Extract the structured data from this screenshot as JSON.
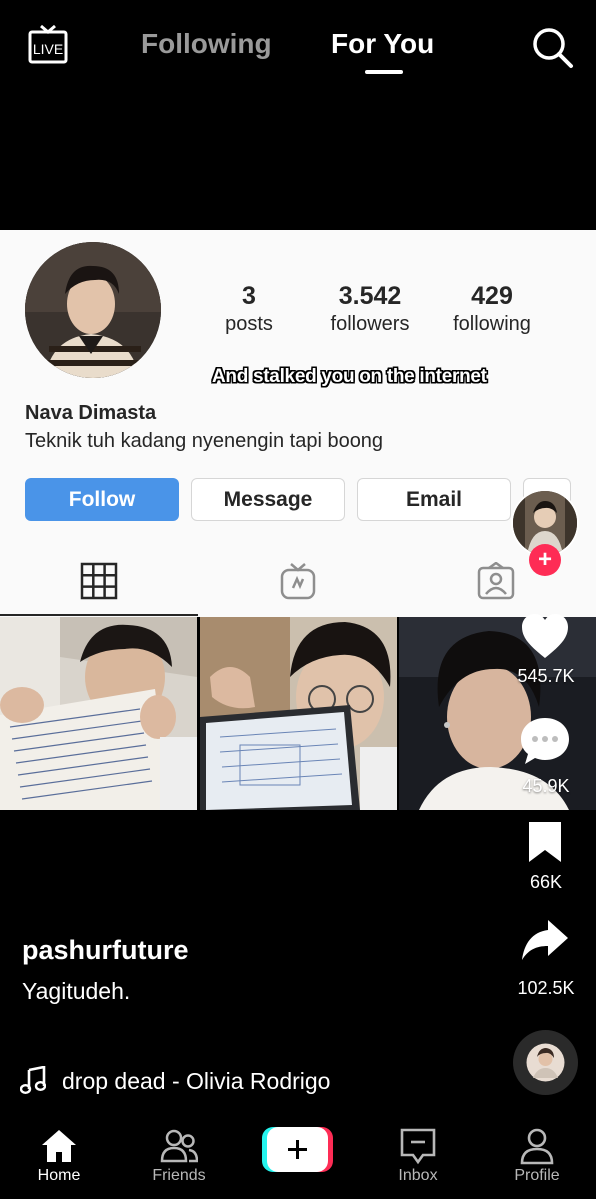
{
  "top_bar": {
    "live_label": "LIVE",
    "tabs": [
      {
        "label": "Following",
        "active": false
      },
      {
        "label": "For You",
        "active": true
      }
    ],
    "icons": {
      "live": "live-tv-icon",
      "search": "search-icon"
    }
  },
  "profile_screenshot": {
    "stats": [
      {
        "value": "3",
        "label": "posts"
      },
      {
        "value": "3.542",
        "label": "followers"
      },
      {
        "value": "429",
        "label": "following"
      }
    ],
    "overlay_caption": "And stalked you on the internet",
    "name": "Nava Dimasta",
    "bio": "Teknik tuh kadang nyenengin tapi boong",
    "buttons": {
      "follow": "Follow",
      "message": "Message",
      "email": "Email"
    },
    "tabs": [
      "grid-icon",
      "igtv-icon",
      "tagged-icon"
    ]
  },
  "actions": {
    "likes": "545.7K",
    "comments": "45.9K",
    "saves": "66K",
    "shares": "102.5K"
  },
  "video": {
    "username": "pashurfuture",
    "description": "Yagitudeh.",
    "music": "drop dead - Olivia Rodrigo"
  },
  "nav": {
    "items": [
      {
        "label": "Home",
        "icon": "home-icon",
        "active": true
      },
      {
        "label": "Friends",
        "icon": "friends-icon",
        "active": false
      },
      {
        "label": "",
        "icon": "plus-icon",
        "active": false
      },
      {
        "label": "Inbox",
        "icon": "inbox-icon",
        "active": false
      },
      {
        "label": "Profile",
        "icon": "profile-icon",
        "active": false
      }
    ]
  },
  "colors": {
    "background": "#000000",
    "follow_button": "#4a94e8",
    "accent_red": "#fe2c55",
    "accent_cyan": "#25f4ee",
    "inactive_tab": "#9a9a9a"
  }
}
